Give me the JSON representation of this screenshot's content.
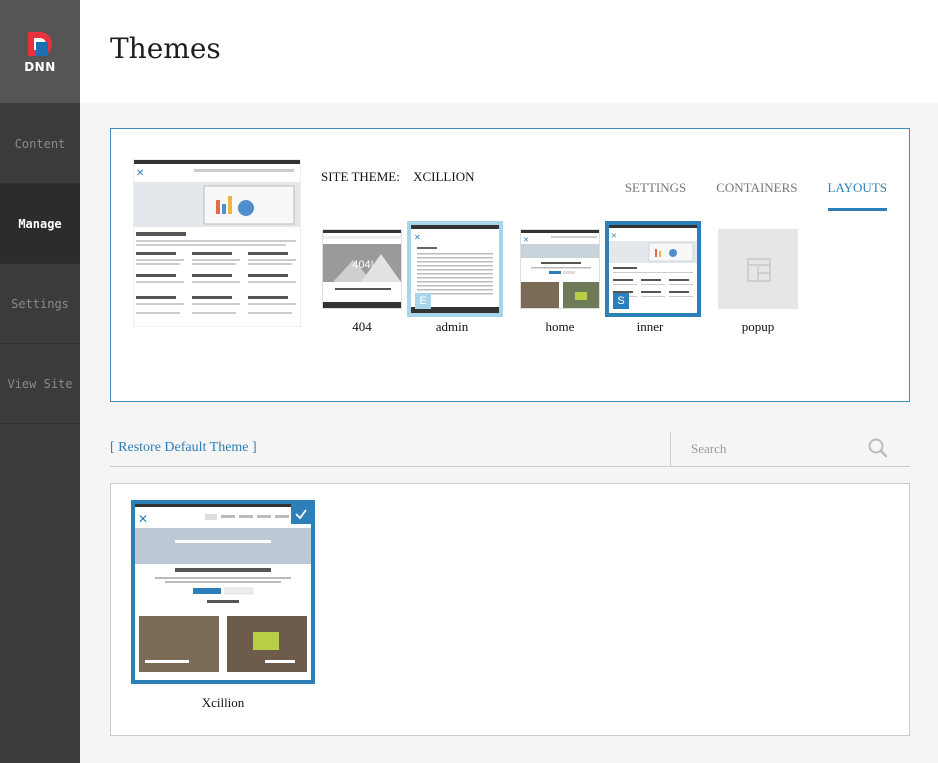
{
  "brand": {
    "logo_text": "DNN"
  },
  "sidebar": {
    "items": [
      {
        "label": "Content"
      },
      {
        "label": "Manage"
      },
      {
        "label": "Settings"
      },
      {
        "label": "View Site"
      }
    ]
  },
  "header": {
    "title": "Themes"
  },
  "site_theme": {
    "label": "SITE THEME:",
    "value": "XCILLION"
  },
  "tabs": [
    {
      "label": "SETTINGS"
    },
    {
      "label": "CONTAINERS"
    },
    {
      "label": "LAYOUTS",
      "active": true
    }
  ],
  "layouts": [
    {
      "name": "404",
      "thumb_heading": "404!"
    },
    {
      "name": "admin",
      "badge": "E"
    },
    {
      "name": "home"
    },
    {
      "name": "inner",
      "badge": "S"
    },
    {
      "name": "popup"
    }
  ],
  "toolbar": {
    "restore_label": "[ Restore Default Theme ]",
    "search_placeholder": "Search"
  },
  "themes": [
    {
      "name": "Xcillion",
      "selected": true
    }
  ],
  "colors": {
    "accent": "#2c7fb8",
    "light_accent": "#a7d6ec",
    "sidebar": "#3b3b3b"
  }
}
